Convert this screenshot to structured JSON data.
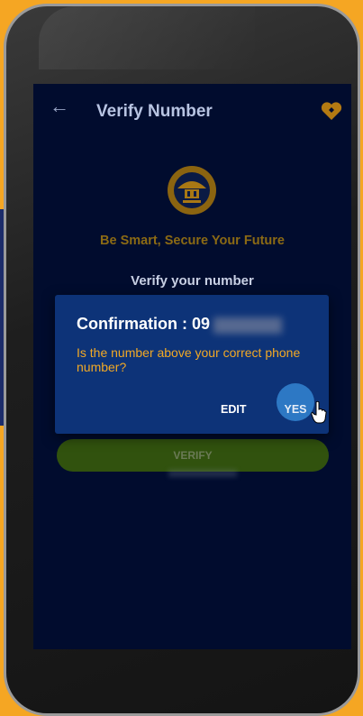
{
  "app_bar": {
    "back_icon": "arrow-left-icon",
    "title": "Verify Number",
    "favorite_icon": "heart-icon"
  },
  "logo": {
    "icon": "organization-seal-logo"
  },
  "tagline": "Be Smart, Secure Your Future",
  "verify_heading": "Verify your number",
  "verify_button_label": "VERIFY",
  "dialog": {
    "title": "Confirmation : 09",
    "message": "Is the number above your correct phone number?",
    "edit_label": "EDIT",
    "yes_label": "YES"
  },
  "cursor": {
    "icon": "hand-pointer-icon"
  },
  "colors": {
    "background": "#f5a623",
    "screen": "#010c2e",
    "dialog": "#0d3378",
    "accent_gold": "#8b6a14",
    "button_green": "#31520e",
    "message_orange": "#f2a925"
  }
}
